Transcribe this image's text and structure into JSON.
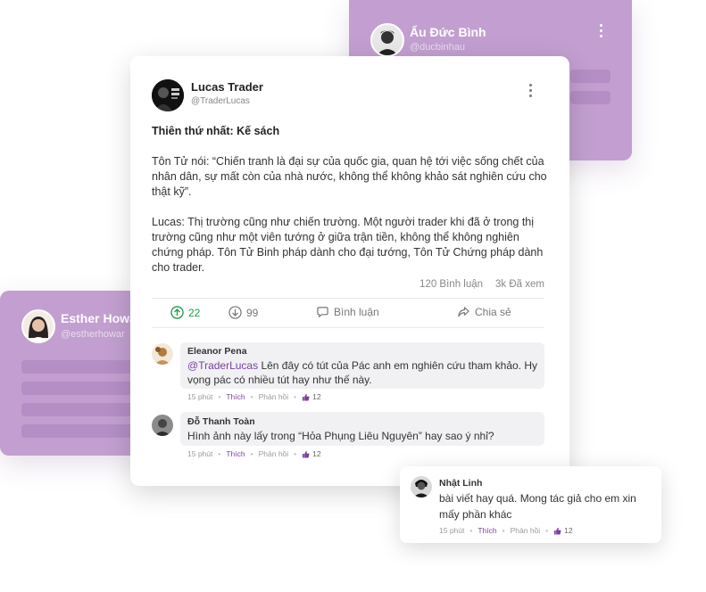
{
  "bg_top": {
    "name": "Ẩu Đức Bình",
    "handle": "@ducbinhau"
  },
  "bg_left": {
    "name": "Esther Howa",
    "handle": "@estherhowar"
  },
  "post": {
    "author": "Lucas Trader",
    "handle": "@TraderLucas",
    "title": "Thiên thứ nhất: Kế sách",
    "paragraphs": [
      "Tôn Tử nói: “Chiến tranh là đại sự của quốc gia, quan hệ tới việc sống chết của nhân dân, sự mất còn của nhà nước, không thể không khảo sát nghiên cứu cho thật kỹ”.",
      "Lucas: Thị trường cũng như chiến trường. Một người trader khi đã ở trong thị trường cũng như một viên tướng ở giữa trận tiền, không thể không nghiên chứng pháp. Tôn Tử Binh pháp dành cho đại tướng, Tôn Tử Chứng pháp dành cho trader."
    ],
    "comments_count": "120 Bình luận",
    "views": "3k Đã xem",
    "upvotes": "22",
    "downvotes": "99",
    "comment_label": "Bình luận",
    "share_label": "Chia sẻ"
  },
  "comments": [
    {
      "name": "Eleanor Pena",
      "mention": "@TraderLucas",
      "text": " Lên đây có tút của Pác anh em nghiên cứu tham khảo. Hy vọng pác có nhiều tút hay như thế này.",
      "time": "15 phút",
      "like": "Thích",
      "reply": "Phản hồi",
      "likes": "12"
    },
    {
      "name": "Đỗ Thanh Toàn",
      "text": "Hình ảnh này lấy trong “Hỏa Phụng Liêu Nguyên” hay sao ý nhỉ?",
      "time": "15 phút",
      "like": "Thích",
      "reply": "Phản hồi",
      "likes": "12"
    }
  ],
  "float_comment": {
    "name": "Nhật Linh",
    "text": "bài viết hay quá. Mong tác giả cho em xin mấy phần khác",
    "time": "15 phút",
    "like": "Thích",
    "reply": "Phản hồi",
    "likes": "12"
  },
  "colors": {
    "purple_bg": "#c29fd0",
    "accent": "#7b3fa1",
    "upvote": "#1e9a47"
  }
}
